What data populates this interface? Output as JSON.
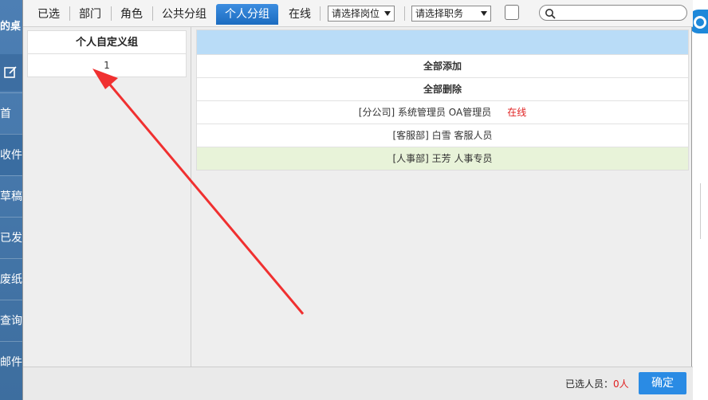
{
  "background": {
    "sidebar_title": "的桌",
    "sidebar_items": [
      "首",
      "收件",
      "草稿",
      "已发",
      "废纸",
      "查询",
      "邮件"
    ]
  },
  "tabs": [
    {
      "label": "已选"
    },
    {
      "label": "部门"
    },
    {
      "label": "角色"
    },
    {
      "label": "公共分组"
    },
    {
      "label": "个人分组"
    },
    {
      "label": "在线"
    }
  ],
  "filters": {
    "position_select": "请选择岗位",
    "duty_select": "请选择职务"
  },
  "left_panel": {
    "header": "个人自定义组",
    "groups": [
      "1"
    ]
  },
  "right_panel": {
    "add_all": "全部添加",
    "remove_all": "全部删除",
    "users": [
      {
        "text": "[分公司] 系统管理员 OA管理员",
        "status": "在线"
      },
      {
        "text": "[客服部] 白雪 客服人员",
        "status": ""
      },
      {
        "text": "[人事部] 王芳 人事专员",
        "status": ""
      }
    ]
  },
  "footer": {
    "selected_label": "已选人员：",
    "selected_count": "0人",
    "confirm_label": "确定"
  },
  "colors": {
    "active_tab": "#1c6cc0",
    "header_blue": "#b9dcf7",
    "highlight_row": "#e8f3d9",
    "online_red": "#e02020",
    "confirm_button": "#2a8be4",
    "annotation_arrow": "#f03030"
  },
  "icons": [
    "edit-icon",
    "search-icon",
    "logo-icon",
    "annotation-arrow"
  ]
}
